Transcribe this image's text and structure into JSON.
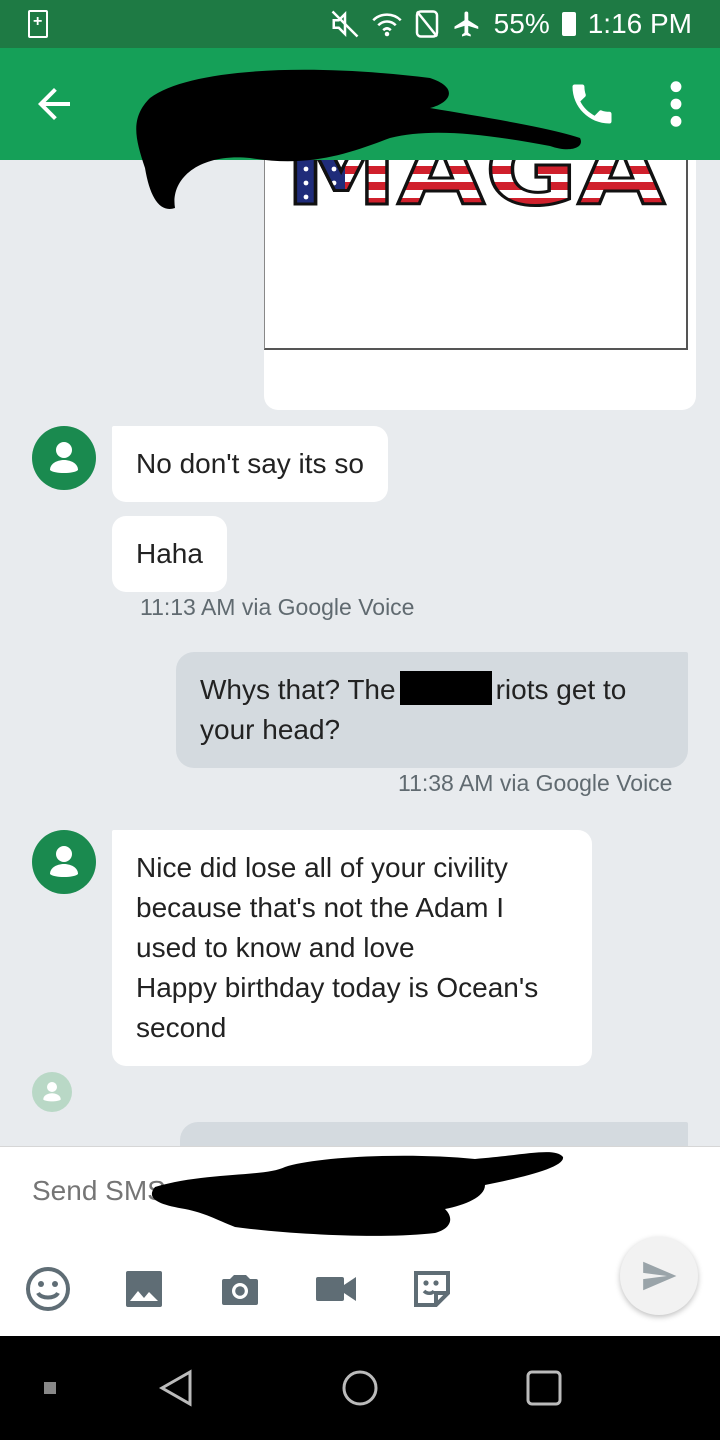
{
  "status_bar": {
    "battery_percent": "55%",
    "time": "1:16 PM",
    "icons": [
      "battery-saver-icon",
      "mute-icon",
      "wifi-icon",
      "nfc-icon",
      "airplane-icon",
      "battery-icon"
    ]
  },
  "app_bar": {
    "back_icon": "back-arrow-icon",
    "call_icon": "phone-icon",
    "menu_icon": "more-vert-icon"
  },
  "messages": {
    "image_text": "MAGA",
    "msg1": "No don't say its so",
    "msg2": "Haha",
    "meta1": "11:13 AM via Google Voice",
    "msg3_before": "Whys that?  The",
    "msg3_after": "riots get to your head?",
    "meta2": "11:38 AM via Google Voice",
    "msg4_line1": "Nice did lose all of your civility",
    "msg4_line2": "because that's not the Adam I",
    "msg4_line3": "used to know and love",
    "msg4_line4": "Happy birthday today is Ocean's",
    "msg4_line5": "second"
  },
  "compose": {
    "placeholder": "Send SMS",
    "icons": [
      "emoji-icon",
      "image-icon",
      "camera-icon",
      "video-icon",
      "sticker-icon",
      "send-icon"
    ]
  },
  "colors": {
    "status_bar": "#1e7a44",
    "app_bar": "#15a058",
    "avatar": "#1a8a4f",
    "background": "#e8ebee",
    "outgoing_bubble": "#d4dadf"
  }
}
